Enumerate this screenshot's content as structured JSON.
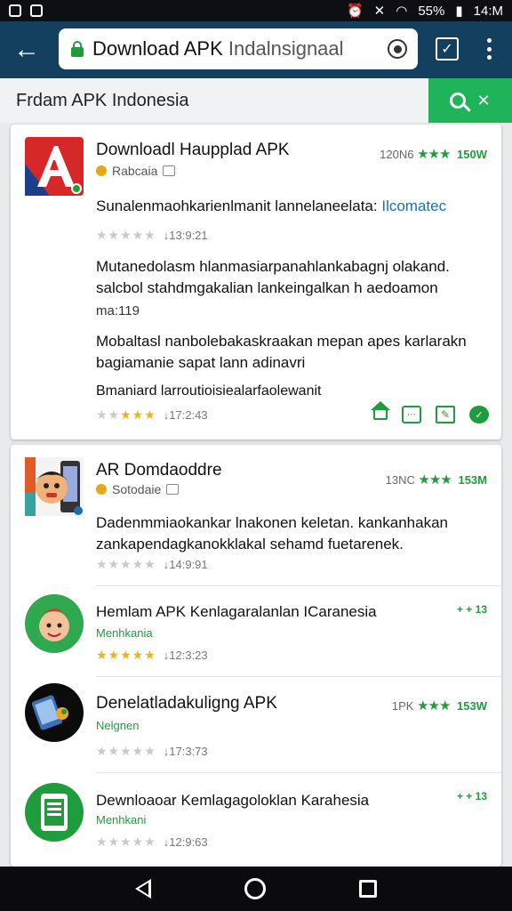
{
  "status_bar": {
    "left_icons": [
      "notification-icon",
      "app-icon"
    ],
    "right_icons": [
      "alarm-icon",
      "mute-icon",
      "wifi-icon",
      "signal-icon",
      "battery-icon"
    ],
    "battery": "55%",
    "time": "14:M"
  },
  "browser": {
    "url_main": "Download APK",
    "url_rest": " Indalnsignaal",
    "back_icon": "arrow-left-icon",
    "record_icon": "record-icon",
    "tabs_icon": "tabs-icon",
    "menu_icon": "more-vert-icon"
  },
  "search": {
    "title": "Frdam APK Indonesia",
    "accent": "#20b45a"
  },
  "card1": {
    "title": "Downloadl Haupplad APK",
    "publisher": "Rabcaia",
    "count": "120N6",
    "stars": "★★★",
    "rating": "150W",
    "desc1_text": "Sunalenmaohkarienlmanit lannelaneelata: ",
    "desc1_link": "Ilcomatec",
    "meta1_stars": "★★★★★",
    "meta1_value": "↓13:9:21",
    "desc2": "Mutanedolasm hlanmasiarpanahlankabagnj olakand. salcbol stahdmgakalian lankeingalkan h aedoamon",
    "desc2_tail": "ma:119",
    "desc3": "Mobaltasl nanbolebakaskraakan mepan apes karlarakn bagiamanie sapat lann adinavri",
    "desc4": "Bmaniard larroutioisiealarfaolewanit",
    "meta2_stars_gold": "★★★",
    "meta2_stars_grey": "★★",
    "meta2_value": "↓17:2:43",
    "actions": [
      "home-icon",
      "message-icon",
      "edit-icon",
      "badge-icon"
    ]
  },
  "card2": {
    "app1": {
      "title": "AR Domdaoddre",
      "publisher": "Sotodaie",
      "count": "13NC",
      "stars": "★★★",
      "rating": "153M",
      "desc": "Dadenmmiaokankar lnakonen keletan. kankanhakan zankapendagkanokklakal sehamd fuetarenek.",
      "stars_grey": "★★★★★",
      "value": "↓14:9:91"
    },
    "app2": {
      "title": "Hemlam APK Kenlagaralanlan ICaranesia",
      "subtitle": "Menhkania",
      "badge": "+ + 13",
      "stars_gold": "★★★★★",
      "value": "↓12:3:23"
    },
    "app3": {
      "title": "Denelatladakuligng APK",
      "subtitle": "Nelgnen",
      "count": "1PK",
      "stars": "★★★",
      "rating": "153W",
      "stars_grey": "★★★★★",
      "value": "↓17:3:73"
    },
    "app4": {
      "title": "Dewnloaoar Kemlagagoloklan Karahesia",
      "subtitle": "Menhkani",
      "badge": "+ + 13",
      "stars_grey": "★★★★★",
      "value": "↓12:9:63"
    }
  },
  "nav_bar": {
    "icons": [
      "nav-back-icon",
      "nav-home-icon",
      "nav-recent-icon"
    ]
  }
}
